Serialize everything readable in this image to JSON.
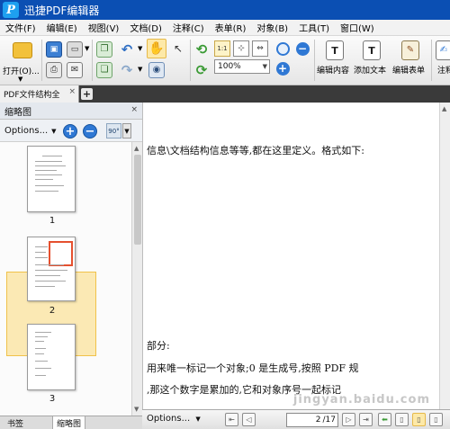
{
  "window": {
    "title": "迅捷PDF编辑器",
    "app_icon": "P"
  },
  "menu": [
    "文件(F)",
    "编辑(E)",
    "视图(V)",
    "文档(D)",
    "注释(C)",
    "表单(R)",
    "对象(B)",
    "工具(T)",
    "窗口(W)"
  ],
  "toolbar": {
    "open_label": "打开(O)...",
    "zoom_value": "100%",
    "edit_content_label": "编辑内容",
    "add_text_label": "添加文本",
    "edit_form_label": "编辑表单",
    "annotate_label": "注释"
  },
  "tabs": {
    "doc_tab": "PDF文件结构全",
    "close": "×",
    "add": "+"
  },
  "side_panel": {
    "title": "缩略图",
    "close": "×",
    "options_label": "Options...",
    "rotate_label": "90°",
    "thumbnails": [
      {
        "page": "1"
      },
      {
        "page": "2",
        "selected": true
      },
      {
        "page": "3"
      }
    ],
    "bottom_tabs": [
      "书签",
      "缩略图"
    ]
  },
  "document": {
    "lines": [
      "信息\\文档结构信息等等,都在这里定义。格式如下:",
      "部分:",
      "用来唯一标记一个对象;0 是生成号,按照 PDF 规",
      ",那这个数字是累加的,它和对象序号一起标记"
    ],
    "watermark": "jingyan.baidu.com"
  },
  "status": {
    "options_label": "Options...",
    "page_current": "2",
    "page_total": "/17"
  },
  "colors": {
    "titlebar": "#0b4fb3",
    "selection": "#fbe9b4",
    "view_box": "#e5502f",
    "accent_blue": "#2f78d4"
  }
}
